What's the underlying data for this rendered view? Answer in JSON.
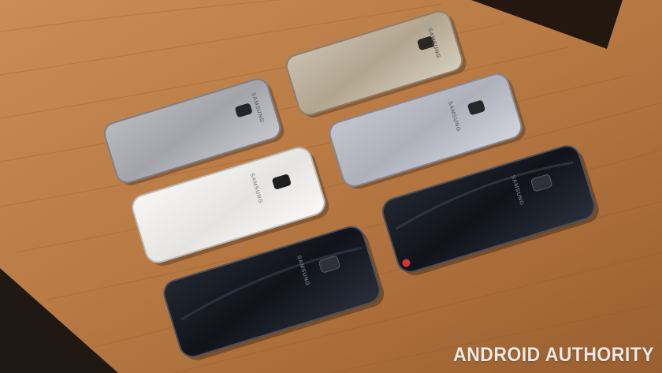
{
  "photo": {
    "brand_text": "SAMSUNG",
    "watermark": "ANDROID AUTHORITY",
    "phones": [
      {
        "id": "gold-top",
        "finish": "gold",
        "color": "#b7aa98"
      },
      {
        "id": "silver-left",
        "finish": "silver",
        "color": "#a9aab0"
      },
      {
        "id": "silver-right",
        "finish": "silver",
        "color": "#b6b8c1"
      },
      {
        "id": "white",
        "finish": "white",
        "color": "#ecebea"
      },
      {
        "id": "black-right",
        "finish": "black",
        "color": "#181b22"
      },
      {
        "id": "black-bottom",
        "finish": "black",
        "color": "#151820"
      }
    ]
  }
}
